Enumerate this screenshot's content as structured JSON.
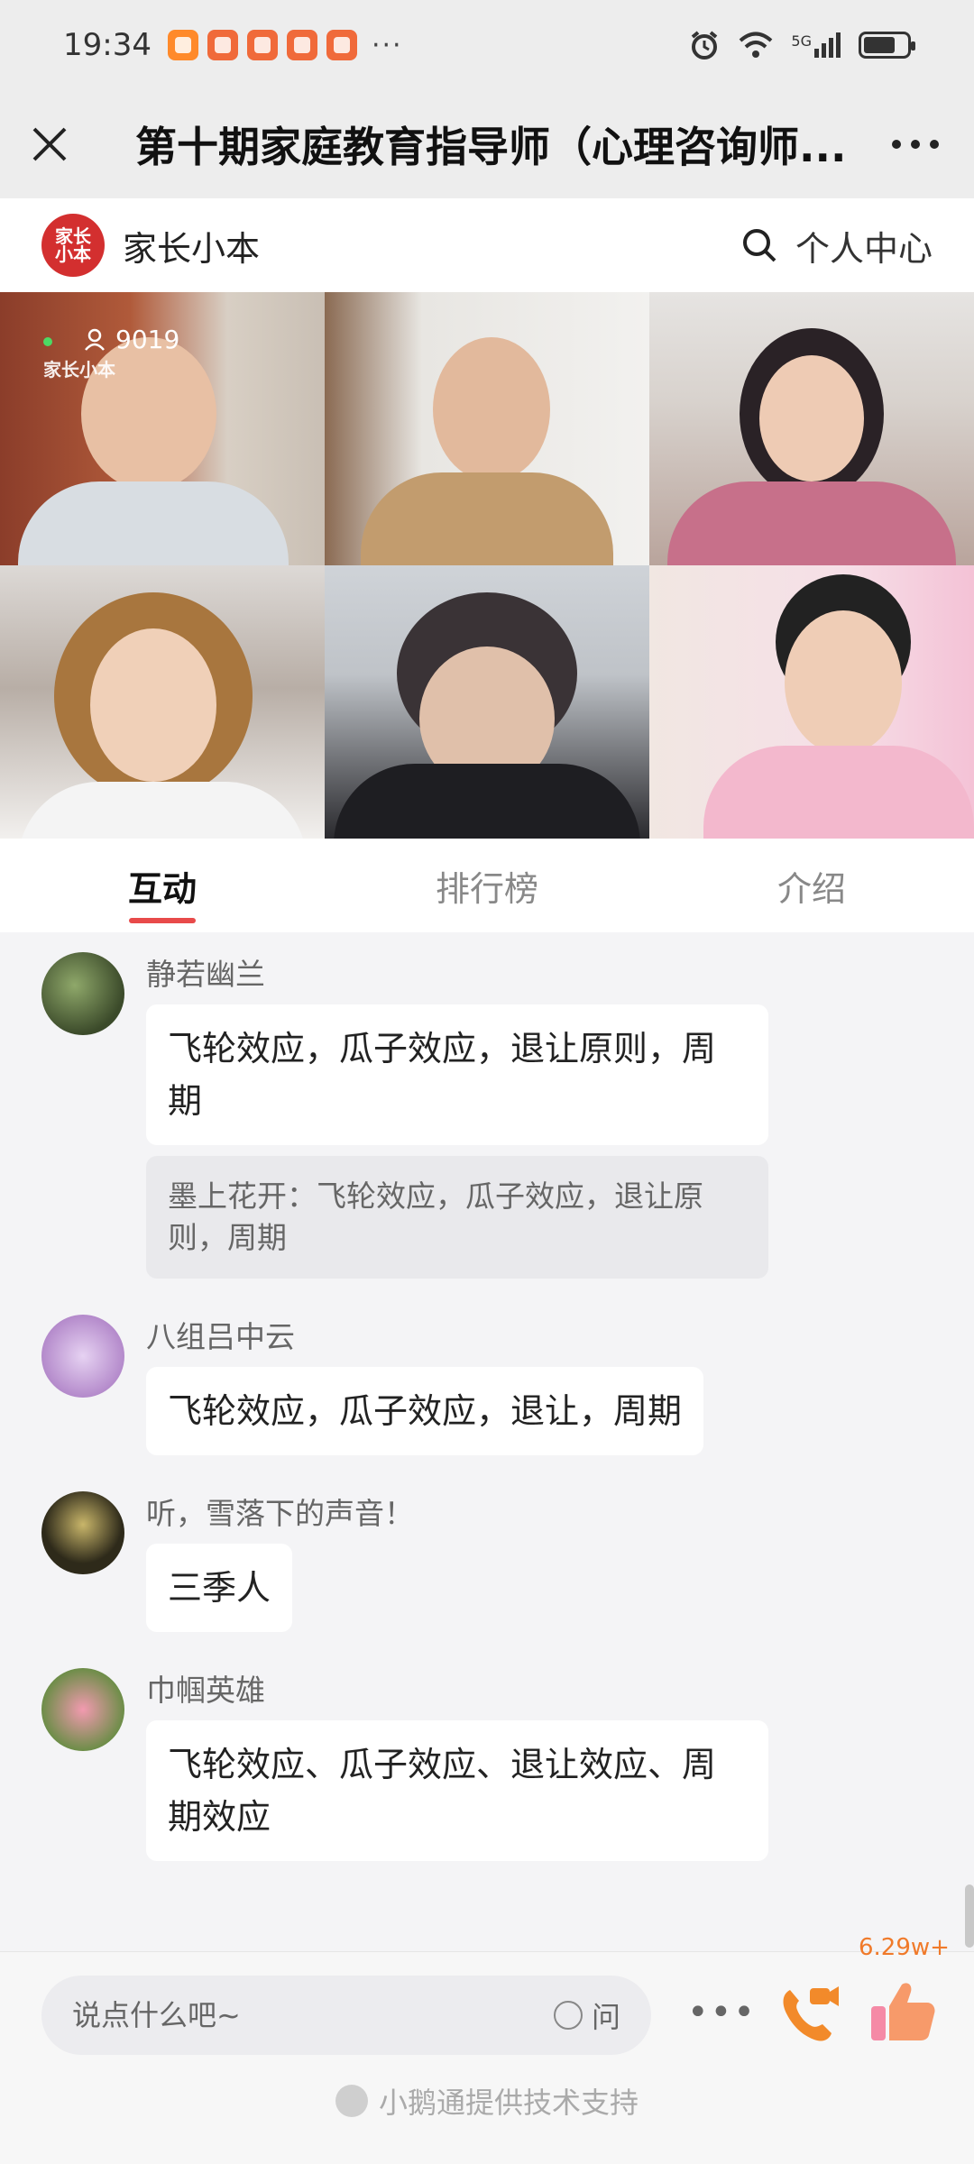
{
  "status_bar": {
    "time": "19:34",
    "more": "···",
    "network": "5G"
  },
  "title_bar": {
    "title": "第十期家庭教育指导师（心理咨询师..."
  },
  "brand": {
    "logo_text": "家长小本",
    "name": "家长小本",
    "personal_center": "个人中心"
  },
  "video": {
    "viewer_count": "9019",
    "watermark": "家长小本"
  },
  "tabs": [
    {
      "label": "互动",
      "active": true
    },
    {
      "label": "排行榜",
      "active": false
    },
    {
      "label": "介绍",
      "active": false
    }
  ],
  "messages": [
    {
      "name": "静若幽兰",
      "text": "飞轮效应，瓜子效应，退让原则，周期",
      "quote": "墨上花开：飞轮效应，瓜子效应，退让原则，周期"
    },
    {
      "name": "八组吕中云",
      "text": "飞轮效应，瓜子效应，退让，周期"
    },
    {
      "name": "听，雪落下的声音！",
      "text": "三季人"
    },
    {
      "name": "巾帼英雄",
      "text": "飞轮效应、瓜子效应、退让效应、周期效应"
    }
  ],
  "bottom": {
    "input_placeholder": "说点什么吧~",
    "ask_label": "问",
    "more": "•••",
    "like_count": "6.29w+",
    "powered_by": "小鹅通提供技术支持"
  },
  "colors": {
    "accent": "#e84a4a",
    "brand_red": "#d32f2f",
    "like_orange": "#f07a2a"
  }
}
